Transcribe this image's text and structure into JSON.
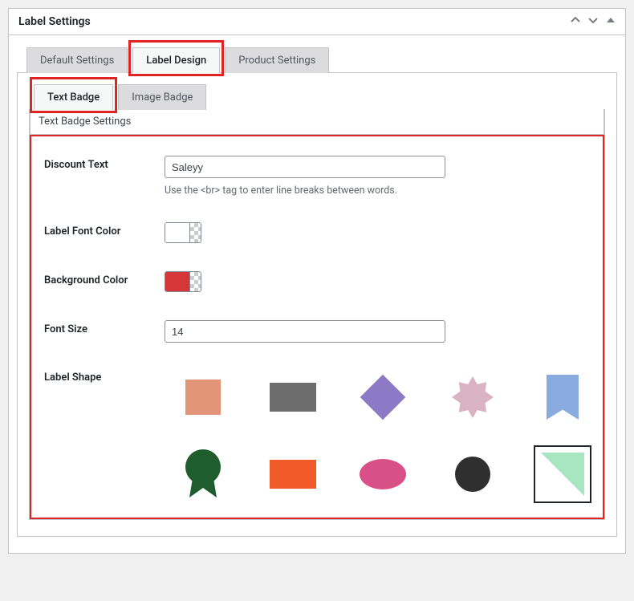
{
  "panel": {
    "title": "Label Settings"
  },
  "tabs": {
    "default_settings": "Default Settings",
    "label_design": "Label Design",
    "product_settings": "Product Settings"
  },
  "subtabs": {
    "text_badge": "Text Badge",
    "image_badge": "Image Badge"
  },
  "section": {
    "title": "Text Badge Settings"
  },
  "form": {
    "discount_text": {
      "label": "Discount Text",
      "value": "Saleyy",
      "helper": "Use the <br> tag to enter line breaks between words."
    },
    "label_font_color": {
      "label": "Label Font Color",
      "value": "#ffffff"
    },
    "background_color": {
      "label": "Background Color",
      "value": "#d63638"
    },
    "font_size": {
      "label": "Font Size",
      "value": "14"
    },
    "label_shape": {
      "label": "Label Shape",
      "selected": "triangle"
    }
  }
}
